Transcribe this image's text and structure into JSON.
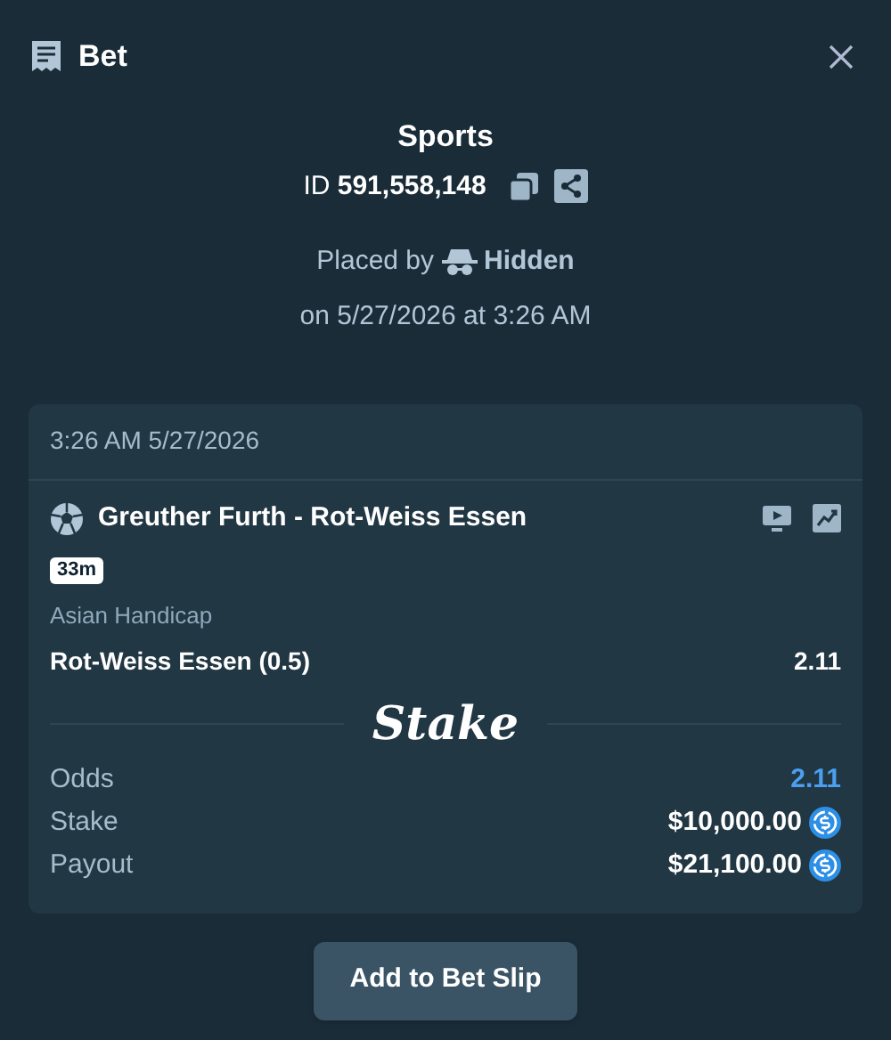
{
  "header": {
    "title": "Bet"
  },
  "summary": {
    "category": "Sports",
    "id_label": "ID",
    "id_value": "591,558,148",
    "placed_by_label": "Placed by",
    "placed_by_user": "Hidden",
    "placed_on": "on 5/27/2026 at 3:26 AM"
  },
  "card": {
    "timestamp": "3:26 AM 5/27/2026",
    "event": "Greuther Furth - Rot-Weiss Essen",
    "live_time": "33m",
    "market": "Asian Handicap",
    "selection": "Rot-Weiss Essen (0.5)",
    "selection_odds": "2.11",
    "logo": "Stake",
    "totals": [
      {
        "kind": "odds",
        "label": "Odds",
        "value": "2.11"
      },
      {
        "kind": "amount",
        "label": "Stake",
        "value": "$10,000.00"
      },
      {
        "kind": "amount",
        "label": "Payout",
        "value": "$21,100.00"
      }
    ]
  },
  "action": {
    "label": "Add to Bet Slip"
  }
}
